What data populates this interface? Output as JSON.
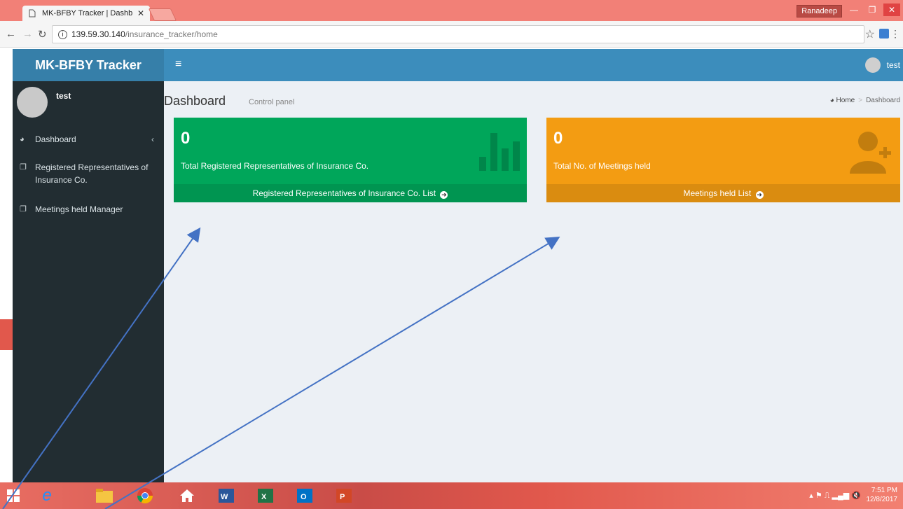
{
  "browser": {
    "tab_title": "MK-BFBY Tracker | Dashb",
    "url_host": "139.59.30.140",
    "url_path": "/insurance_tracker/home",
    "window_user": "Ranadeep"
  },
  "header": {
    "logo": "MK-BFBY Tracker",
    "user_name": "test"
  },
  "sidebar": {
    "user_name": "test",
    "items": [
      {
        "label": "Dashboard",
        "icon": "dashboard-icon"
      },
      {
        "label": "Registered Representatives of Insurance Co.",
        "icon": "copy-icon"
      },
      {
        "label": "Meetings held Manager",
        "icon": "copy-icon"
      }
    ]
  },
  "page": {
    "title": "Dashboard",
    "subtitle": "Control panel",
    "breadcrumb": [
      "Home",
      "Dashboard"
    ]
  },
  "boxes": [
    {
      "value": "0",
      "label": "Total Registered Representatives of Insurance Co.",
      "footer": "Registered Representatives of Insurance Co. List",
      "color": "#00a65a",
      "icon": "bar-chart-icon"
    },
    {
      "value": "0",
      "label": "Total No. of Meetings held",
      "footer": "Meetings held List",
      "color": "#f39c12",
      "icon": "user-plus-icon"
    }
  ],
  "taskbar": {
    "time": "7:51 PM",
    "date": "12/8/2017"
  }
}
